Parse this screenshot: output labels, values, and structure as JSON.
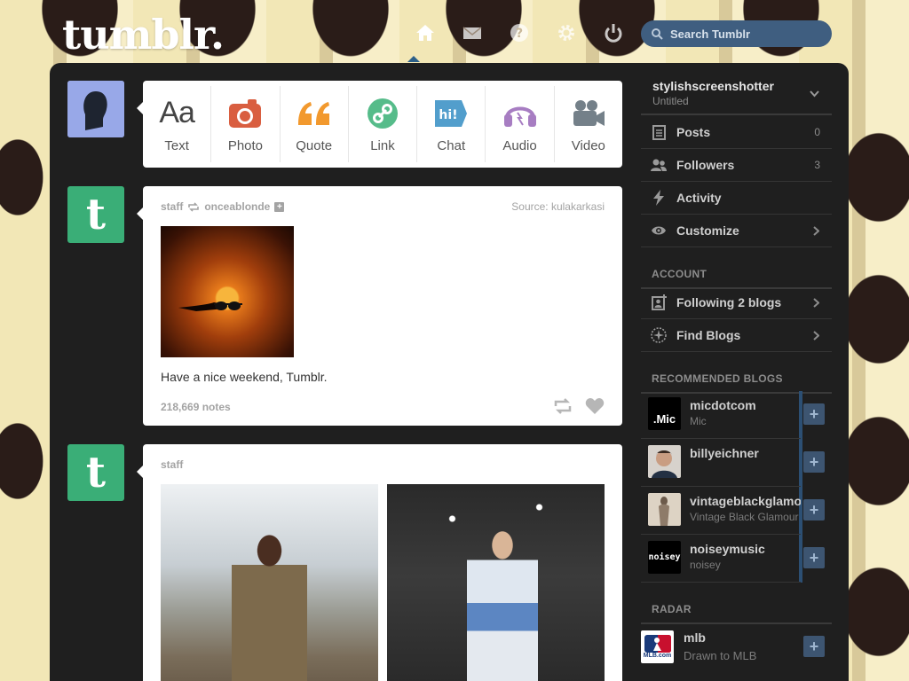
{
  "header": {
    "logo": "tumblr.",
    "nav": [
      "home-icon",
      "inbox-icon",
      "help-icon",
      "settings-icon",
      "logout-icon"
    ],
    "search_placeholder": "Search Tumblr"
  },
  "post_types": [
    {
      "label": "Text",
      "icon": "text-icon",
      "glyph": "Aa",
      "color": "#444444"
    },
    {
      "label": "Photo",
      "icon": "camera-icon",
      "color": "#d95e40"
    },
    {
      "label": "Quote",
      "icon": "quote-icon",
      "glyph": "“",
      "color": "#f2992e"
    },
    {
      "label": "Link",
      "icon": "link-icon",
      "color": "#56bc8a"
    },
    {
      "label": "Chat",
      "icon": "chat-icon",
      "glyph": "hi!",
      "color": "#529ecc"
    },
    {
      "label": "Audio",
      "icon": "headphones-icon",
      "color": "#a77dc2"
    },
    {
      "label": "Video",
      "icon": "video-camera-icon",
      "color": "#748089"
    }
  ],
  "posts": [
    {
      "author": "staff",
      "reblogged_from": "onceablonde",
      "source_label": "Source:",
      "source": "kulakarkasi",
      "caption": "Have a nice weekend, Tumblr.",
      "notes": "218,669 notes"
    },
    {
      "author": "staff"
    }
  ],
  "sidebar": {
    "blog_name": "stylishscreenshotter",
    "blog_title": "Untitled",
    "menu": [
      {
        "label": "Posts",
        "count": "0",
        "icon": "posts-icon"
      },
      {
        "label": "Followers",
        "count": "3",
        "icon": "followers-icon"
      },
      {
        "label": "Activity",
        "icon": "activity-icon"
      },
      {
        "label": "Customize",
        "icon": "eye-icon"
      }
    ],
    "account_heading": "ACCOUNT",
    "account_items": [
      {
        "label": "Following 2 blogs",
        "icon": "following-icon"
      },
      {
        "label": "Find Blogs",
        "icon": "compass-icon"
      }
    ],
    "recommended_heading": "RECOMMENDED BLOGS",
    "recommended": [
      {
        "name": "micdotcom",
        "title": "Mic",
        "avatar_text": ".Mic"
      },
      {
        "name": "billyeichner",
        "title": ""
      },
      {
        "name": "vintageblackglamour",
        "title": "Vintage Black Glamour"
      },
      {
        "name": "noiseymusic",
        "title": "noisey",
        "avatar_text": "noisey"
      }
    ],
    "radar_heading": "RADAR",
    "radar": {
      "name": "mlb",
      "subtitle": "Drawn to MLB",
      "avatar_text": "MLB.com"
    }
  },
  "colors": {
    "panel": "#1f1f1f",
    "accent": "#529ecc",
    "tumblr_green": "#3aae77",
    "search_bg": "#3f5e80"
  }
}
